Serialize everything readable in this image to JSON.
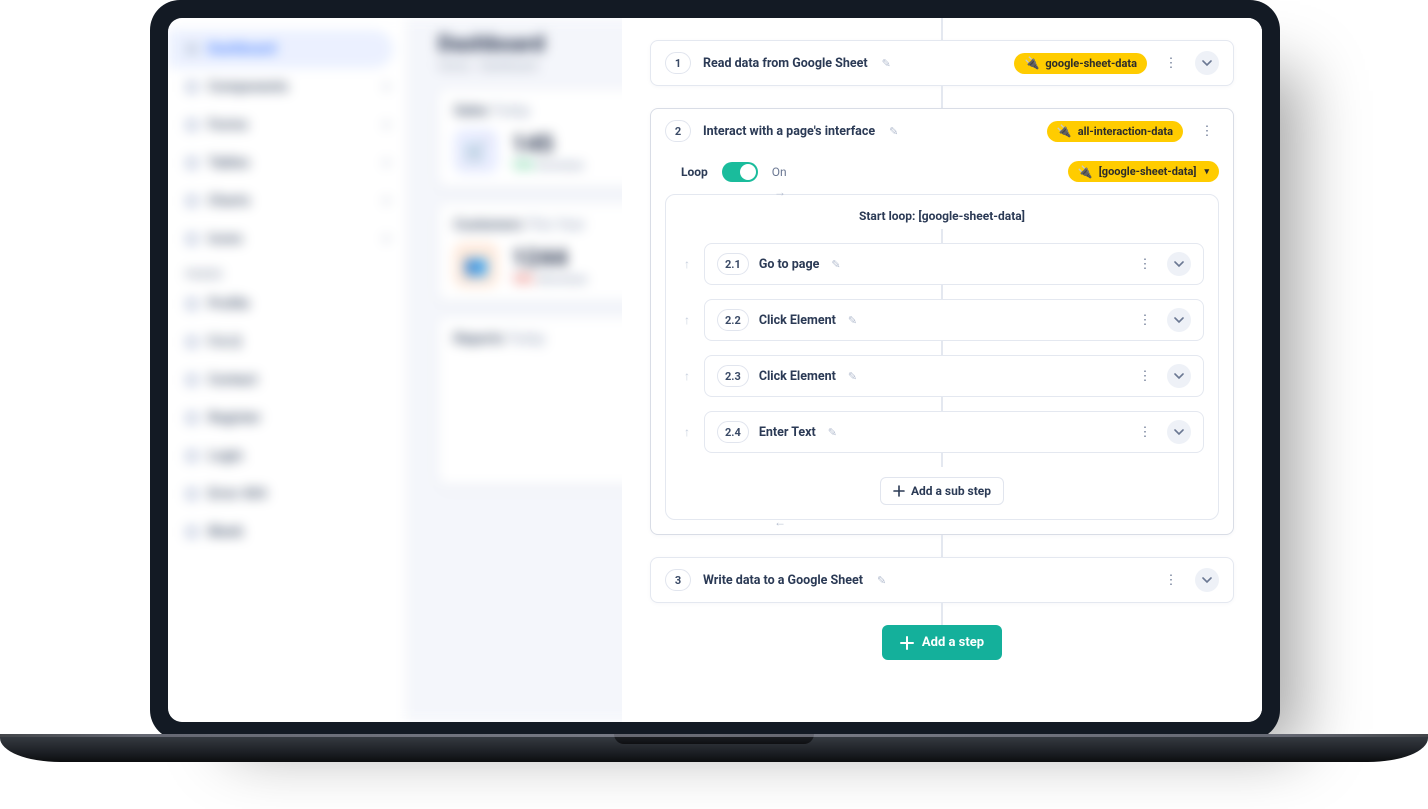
{
  "bg": {
    "title": "Dashboard",
    "crumb": "Home  ·  Dashboard",
    "sidebar": {
      "heading": "PAGES",
      "items": [
        "Dashboard",
        "Components",
        "Forms",
        "Tables",
        "Charts",
        "Icons"
      ],
      "pages": [
        "Profile",
        "F.A.Q",
        "Contact",
        "Register",
        "Login",
        "Error 404",
        "Blank"
      ]
    },
    "cards": {
      "sales": {
        "h": "Sales",
        "v": "145",
        "sub": "12%"
      },
      "customers": {
        "h": "Customers",
        "v": "1244",
        "sub": "18%"
      },
      "reports": {
        "h": "Reports"
      }
    }
  },
  "panel": {
    "steps": {
      "s1": {
        "num": "1",
        "title": "Read data from Google Sheet",
        "chip": "google-sheet-data"
      },
      "s2": {
        "num": "2",
        "title": "Interact with a page's interface",
        "chip": "all-interaction-data",
        "loop": {
          "label": "Loop",
          "state": "On",
          "source": "[google-sheet-data]",
          "startLabel": "Start loop: [google-sheet-data]"
        },
        "subs": [
          {
            "num": "2.1",
            "title": "Go to page"
          },
          {
            "num": "2.2",
            "title": "Click Element"
          },
          {
            "num": "2.3",
            "title": "Click Element"
          },
          {
            "num": "2.4",
            "title": "Enter Text"
          }
        ],
        "addSub": "Add a sub step"
      },
      "s3": {
        "num": "3",
        "title": "Write data to a Google Sheet"
      }
    },
    "addStep": "Add a step"
  }
}
